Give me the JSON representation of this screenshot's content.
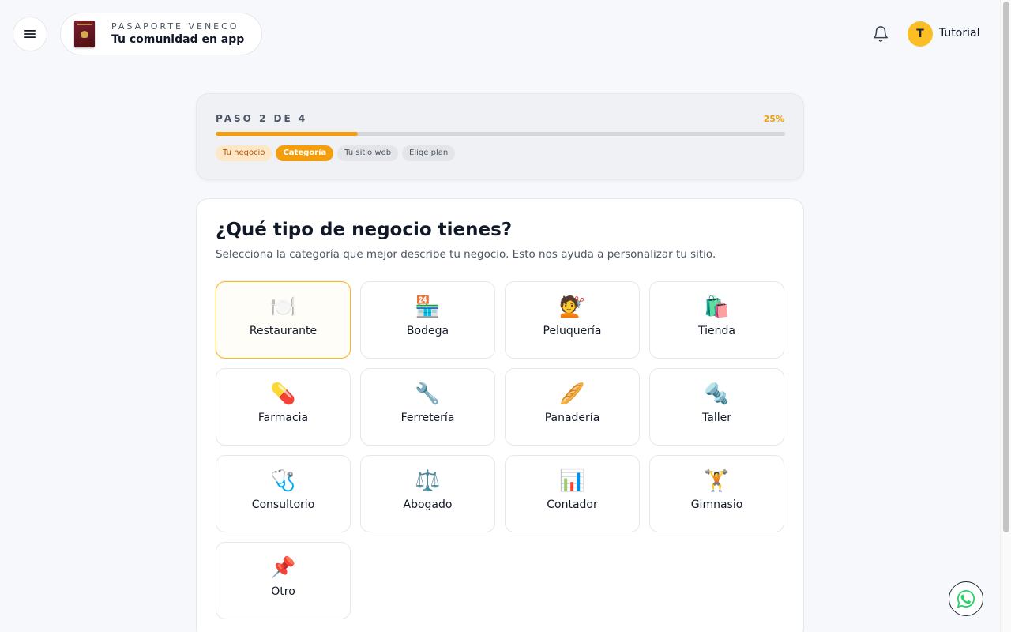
{
  "header": {
    "brand_top": "PASAPORTE VENECO",
    "brand_sub": "Tu comunidad en app",
    "user_initial": "T",
    "user_name": "Tutorial"
  },
  "progress": {
    "step_label": "PASO 2 DE 4",
    "percent_label": "25%",
    "percent_value": 25,
    "steps": [
      {
        "label": "Tu negocio",
        "state": "done"
      },
      {
        "label": "Categoría",
        "state": "active"
      },
      {
        "label": "Tu sitio web",
        "state": "pending"
      },
      {
        "label": "Elige plan",
        "state": "pending"
      }
    ]
  },
  "main": {
    "title": "¿Qué tipo de negocio tienes?",
    "subtitle": "Selecciona la categoría que mejor describe tu negocio. Esto nos ayuda a personalizar tu sitio.",
    "categories": [
      {
        "label": "Restaurante",
        "icon": "🍽️",
        "icon_name": "plate-icon",
        "selected": true
      },
      {
        "label": "Bodega",
        "icon": "🏪",
        "icon_name": "store-icon",
        "selected": false
      },
      {
        "label": "Peluquería",
        "icon": "💇",
        "icon_name": "haircut-icon",
        "selected": false
      },
      {
        "label": "Tienda",
        "icon": "🛍️",
        "icon_name": "shopping-bags-icon",
        "selected": false
      },
      {
        "label": "Farmacia",
        "icon": "💊",
        "icon_name": "pill-icon",
        "selected": false
      },
      {
        "label": "Ferretería",
        "icon": "🔧",
        "icon_name": "wrench-icon",
        "selected": false
      },
      {
        "label": "Panadería",
        "icon": "🥖",
        "icon_name": "baguette-icon",
        "selected": false
      },
      {
        "label": "Taller",
        "icon": "🔩",
        "icon_name": "nut-bolt-icon",
        "selected": false
      },
      {
        "label": "Consultorio",
        "icon": "🩺",
        "icon_name": "stethoscope-icon",
        "selected": false
      },
      {
        "label": "Abogado",
        "icon": "⚖️",
        "icon_name": "scales-icon",
        "selected": false
      },
      {
        "label": "Contador",
        "icon": "📊",
        "icon_name": "bar-chart-icon",
        "selected": false
      },
      {
        "label": "Gimnasio",
        "icon": "🏋️",
        "icon_name": "weightlifter-icon",
        "selected": false
      },
      {
        "label": "Otro",
        "icon": "📌",
        "icon_name": "pushpin-icon",
        "selected": false
      }
    ]
  },
  "colors": {
    "accent": "#f59e0b",
    "avatar": "#fbbf24",
    "whatsapp": "#25d366"
  }
}
